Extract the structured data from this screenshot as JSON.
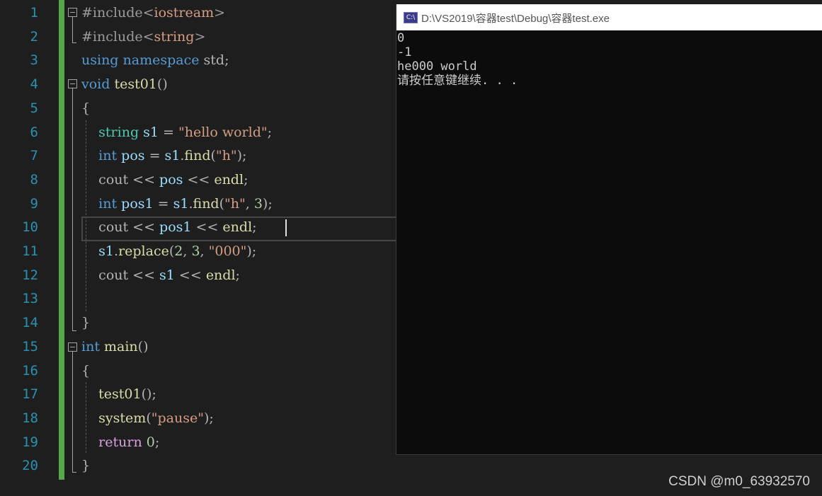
{
  "editor": {
    "line_numbers": [
      "1",
      "2",
      "3",
      "4",
      "5",
      "6",
      "7",
      "8",
      "9",
      "10",
      "11",
      "12",
      "13",
      "14",
      "15",
      "16",
      "17",
      "18",
      "19",
      "20"
    ],
    "lines": [
      [
        {
          "t": "#include<",
          "c": "inc"
        },
        {
          "t": "iostream",
          "c": "str"
        },
        {
          "t": ">",
          "c": "inc"
        }
      ],
      [
        {
          "t": "#include<",
          "c": "inc"
        },
        {
          "t": "string",
          "c": "str"
        },
        {
          "t": ">",
          "c": "inc"
        }
      ],
      [
        {
          "t": "using ",
          "c": "kw"
        },
        {
          "t": "namespace ",
          "c": "kw"
        },
        {
          "t": "std;",
          "c": "pl"
        }
      ],
      [
        {
          "t": "void ",
          "c": "kw"
        },
        {
          "t": "test01",
          "c": "fn"
        },
        {
          "t": "()",
          "c": "pl"
        }
      ],
      [
        {
          "t": "{",
          "c": "pl"
        }
      ],
      [
        {
          "t": "    ",
          "c": "pl"
        },
        {
          "t": "string ",
          "c": "ty"
        },
        {
          "t": "s1",
          "c": "var"
        },
        {
          "t": " = ",
          "c": "pl"
        },
        {
          "t": "\"hello world\"",
          "c": "str"
        },
        {
          "t": ";",
          "c": "pl"
        }
      ],
      [
        {
          "t": "    ",
          "c": "pl"
        },
        {
          "t": "int ",
          "c": "kw"
        },
        {
          "t": "pos",
          "c": "var"
        },
        {
          "t": " = ",
          "c": "pl"
        },
        {
          "t": "s1",
          "c": "var"
        },
        {
          "t": ".",
          "c": "pl"
        },
        {
          "t": "find",
          "c": "fn"
        },
        {
          "t": "(",
          "c": "pl"
        },
        {
          "t": "\"h\"",
          "c": "str"
        },
        {
          "t": ");",
          "c": "pl"
        }
      ],
      [
        {
          "t": "    ",
          "c": "pl"
        },
        {
          "t": "cout",
          "c": "pl"
        },
        {
          "t": " << ",
          "c": "pl"
        },
        {
          "t": "pos",
          "c": "var"
        },
        {
          "t": " << ",
          "c": "pl"
        },
        {
          "t": "endl",
          "c": "fn"
        },
        {
          "t": ";",
          "c": "pl"
        }
      ],
      [
        {
          "t": "    ",
          "c": "pl"
        },
        {
          "t": "int ",
          "c": "kw"
        },
        {
          "t": "pos1",
          "c": "var"
        },
        {
          "t": " = ",
          "c": "pl"
        },
        {
          "t": "s1",
          "c": "var"
        },
        {
          "t": ".",
          "c": "pl"
        },
        {
          "t": "find",
          "c": "fn"
        },
        {
          "t": "(",
          "c": "pl"
        },
        {
          "t": "\"h\"",
          "c": "str"
        },
        {
          "t": ", ",
          "c": "pl"
        },
        {
          "t": "3",
          "c": "num"
        },
        {
          "t": ");",
          "c": "pl"
        }
      ],
      [
        {
          "t": "    ",
          "c": "pl"
        },
        {
          "t": "cout",
          "c": "pl"
        },
        {
          "t": " << ",
          "c": "pl"
        },
        {
          "t": "pos1",
          "c": "var"
        },
        {
          "t": " << ",
          "c": "pl"
        },
        {
          "t": "endl",
          "c": "fn"
        },
        {
          "t": ";",
          "c": "pl"
        }
      ],
      [
        {
          "t": "    ",
          "c": "pl"
        },
        {
          "t": "s1",
          "c": "var"
        },
        {
          "t": ".",
          "c": "pl"
        },
        {
          "t": "replace",
          "c": "fn"
        },
        {
          "t": "(",
          "c": "pl"
        },
        {
          "t": "2",
          "c": "num"
        },
        {
          "t": ", ",
          "c": "pl"
        },
        {
          "t": "3",
          "c": "num"
        },
        {
          "t": ", ",
          "c": "pl"
        },
        {
          "t": "\"000\"",
          "c": "str"
        },
        {
          "t": ");",
          "c": "pl"
        }
      ],
      [
        {
          "t": "    ",
          "c": "pl"
        },
        {
          "t": "cout",
          "c": "pl"
        },
        {
          "t": " << ",
          "c": "pl"
        },
        {
          "t": "s1",
          "c": "var"
        },
        {
          "t": " << ",
          "c": "pl"
        },
        {
          "t": "endl",
          "c": "fn"
        },
        {
          "t": ";",
          "c": "pl"
        }
      ],
      [],
      [
        {
          "t": "}",
          "c": "pl"
        }
      ],
      [
        {
          "t": "int ",
          "c": "kw"
        },
        {
          "t": "main",
          "c": "fn"
        },
        {
          "t": "()",
          "c": "pl"
        }
      ],
      [
        {
          "t": "{",
          "c": "pl"
        }
      ],
      [
        {
          "t": "    ",
          "c": "pl"
        },
        {
          "t": "test01",
          "c": "fn"
        },
        {
          "t": "();",
          "c": "pl"
        }
      ],
      [
        {
          "t": "    ",
          "c": "pl"
        },
        {
          "t": "system",
          "c": "fn"
        },
        {
          "t": "(",
          "c": "pl"
        },
        {
          "t": "\"pause\"",
          "c": "str"
        },
        {
          "t": ");",
          "c": "pl"
        }
      ],
      [
        {
          "t": "    ",
          "c": "pl"
        },
        {
          "t": "return ",
          "c": "ctl"
        },
        {
          "t": "0",
          "c": "num"
        },
        {
          "t": ";",
          "c": "pl"
        }
      ],
      [
        {
          "t": "}",
          "c": "pl"
        }
      ]
    ]
  },
  "console": {
    "title": "D:\\VS2019\\容器test\\Debug\\容器test.exe",
    "icon_label": "C:\\",
    "output": [
      "0",
      "-1",
      "he000 world",
      "请按任意键继续. . ."
    ]
  },
  "watermark": "CSDN @m0_63932570",
  "colors": {
    "background": "#1e1e1e",
    "line_number": "#2b91af",
    "keyword": "#569cd6",
    "type": "#4ec9b0",
    "function": "#dcdcaa",
    "variable": "#9cdcfe",
    "string": "#d69d85",
    "number": "#b5cea8",
    "control": "#d8a0df",
    "change_bar": "#57a64a"
  }
}
